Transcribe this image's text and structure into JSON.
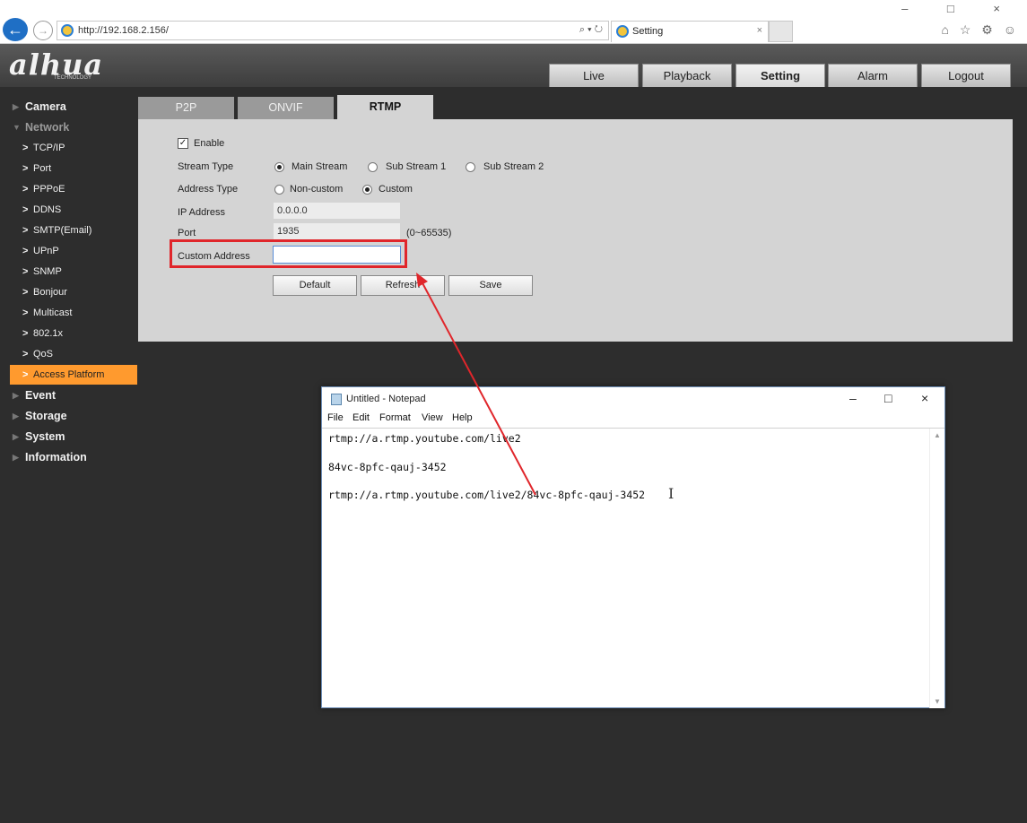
{
  "browser": {
    "url": "http://192.168.2.156/",
    "search_controls": "⌕ ▾ ↻",
    "tab_title": "Setting",
    "tab_close": "×",
    "window_controls": "– □ ×",
    "right_icons": "⌂ ☆ ⚙ ☺"
  },
  "app": {
    "logo": "alhua",
    "logo_sub": "TECHNOLOGY",
    "top_tabs": [
      "Live",
      "Playback",
      "Setting",
      "Alarm",
      "Logout"
    ],
    "active_top_tab": "Setting"
  },
  "sidebar": {
    "categories": {
      "camera": "Camera",
      "network": "Network",
      "event": "Event",
      "storage": "Storage",
      "system": "System",
      "information": "Information"
    },
    "network_items": [
      "TCP/IP",
      "Port",
      "PPPoE",
      "DDNS",
      "SMTP(Email)",
      "UPnP",
      "SNMP",
      "Bonjour",
      "Multicast",
      "802.1x",
      "QoS",
      "Access Platform"
    ],
    "active_item": "Access Platform"
  },
  "sub_tabs": [
    "P2P",
    "ONVIF",
    "RTMP"
  ],
  "active_sub_tab": "RTMP",
  "form": {
    "enable_label": "Enable",
    "enable_checked": true,
    "stream_type_label": "Stream Type",
    "stream_options": [
      "Main Stream",
      "Sub Stream 1",
      "Sub Stream 2"
    ],
    "stream_selected": "Main Stream",
    "address_type_label": "Address Type",
    "address_options": [
      "Non-custom",
      "Custom"
    ],
    "address_selected": "Custom",
    "ip_label": "IP Address",
    "ip_value": "0.0.0.0",
    "port_label": "Port",
    "port_value": "1935",
    "port_range": "(0~65535)",
    "custom_address_label": "Custom Address",
    "custom_address_value": "",
    "buttons": {
      "default": "Default",
      "refresh": "Refresh",
      "save": "Save"
    }
  },
  "notepad": {
    "title": "Untitled - Notepad",
    "controls": {
      "minimize": "–",
      "maximize": "□",
      "close": "×"
    },
    "menu": [
      "File",
      "Edit",
      "Format",
      "View",
      "Help"
    ],
    "lines": [
      "rtmp://a.rtmp.youtube.com/live2",
      "84vc-8pfc-qauj-3452",
      "rtmp://a.rtmp.youtube.com/live2/84vc-8pfc-qauj-3452"
    ],
    "cursor": "I"
  },
  "colors": {
    "accent_active": "#ff9a2e",
    "highlight": "#e0262b",
    "panel": "#d4d4d4",
    "background": "#2d2d2d"
  }
}
